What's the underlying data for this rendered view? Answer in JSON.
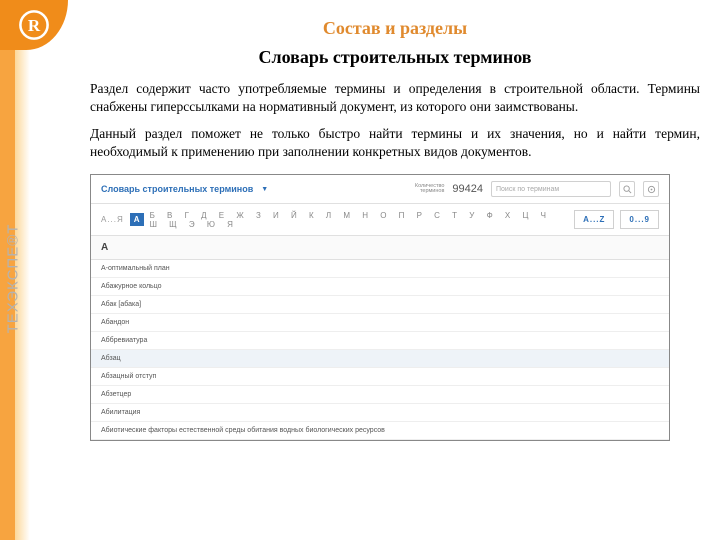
{
  "sidebar": {
    "brand_text": "ТЕХЭКСПЕ®Т"
  },
  "section_title": "Состав и разделы",
  "page_title": "Словарь строительных терминов",
  "paragraph1": "Раздел содержит часто употребляемые термины и определения в строительной области. Термины снабжены гиперссылками на нормативный документ, из которого они заимствованы.",
  "paragraph2": "Данный раздел поможет не только  быстро найти термины и их значения, но и найти термин, необходимый к применению при заполнении конкретных видов документов.",
  "screenshot": {
    "title": "Словарь строительных терминов",
    "count_label": "Количество\nтерминов",
    "count": "99424",
    "search_placeholder": "Поиск по терминам",
    "range_left": "А...Я",
    "selected_letter": "А",
    "letters": "Б В Г Д Е Ж З И Й К Л М Н О П Р С Т У Ф Х Ц Ч Ш Щ Э Ю Я",
    "range_az": "A...Z",
    "range_09": "0...9",
    "letter_head": "А",
    "rows": [
      "А-оптимальный план",
      "Абажурное кольцо",
      "Абак [абака]",
      "Абандон",
      "Аббревиатура",
      "Абзац",
      "Абзацный отступ",
      "Абзетцер",
      "Абилитация",
      "Абиотические факторы естественной среды обитания водных биологических ресурсов"
    ],
    "hover_index": 5
  }
}
